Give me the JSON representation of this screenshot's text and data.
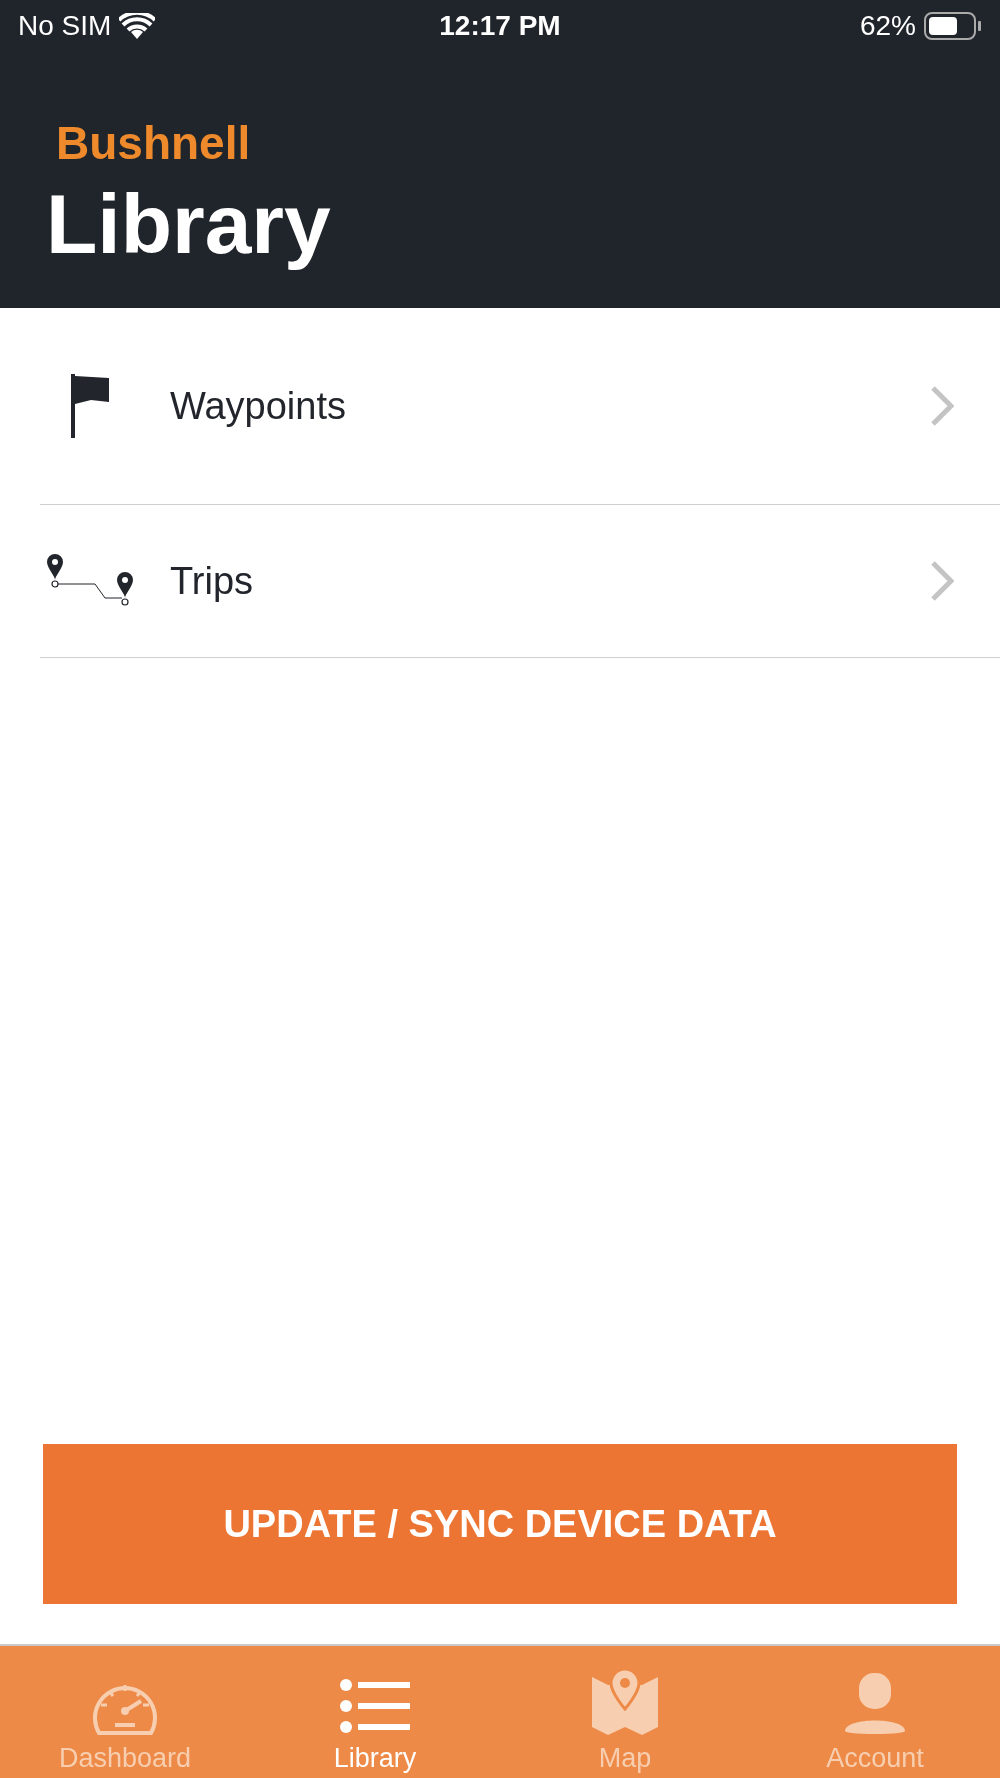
{
  "status_bar": {
    "carrier": "No SIM",
    "time": "12:17 PM",
    "battery": "62%"
  },
  "header": {
    "brand": "Bushnell",
    "title": "Library"
  },
  "items": [
    {
      "label": "Waypoints",
      "kind": "flag"
    },
    {
      "label": "Trips",
      "kind": "route"
    }
  ],
  "action_button": "UPDATE / SYNC DEVICE DATA",
  "tabs": [
    {
      "label": "Dashboard",
      "kind": "gauge",
      "selected": false
    },
    {
      "label": "Library",
      "kind": "list",
      "selected": true
    },
    {
      "label": "Map",
      "kind": "map",
      "selected": false
    },
    {
      "label": "Account",
      "kind": "person",
      "selected": false
    }
  ]
}
